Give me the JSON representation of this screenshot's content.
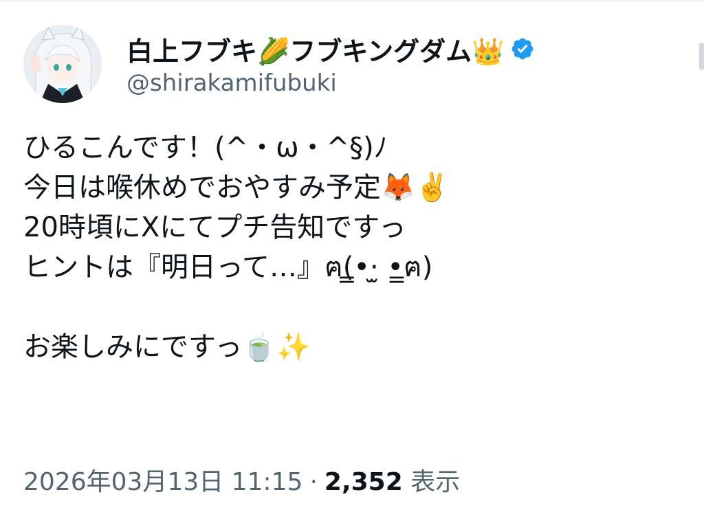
{
  "author": {
    "display_name": "白上フブキ🌽フブキングダム👑",
    "handle": "@shirakamifubuki",
    "avatar_icon": "avatar-illustration",
    "verified_icon": "verified-badge-icon"
  },
  "tweet": {
    "text": "ひるこんです！(^・ω・^§)ﾉ\n今日は喉休めでおやすみ予定🦊✌️\n20時頃にXにてプチ告知ですっ\nヒントは『明日って…』ฅ(̳•·̫ •̳ฅ)\n\nお楽しみにですっ🍵✨"
  },
  "meta": {
    "timestamp": "2026年03月13日 11:15",
    "separator": "·",
    "views_count": "2,352",
    "views_label": "表示"
  },
  "colors": {
    "text_primary": "#0f1419",
    "text_secondary": "#536471",
    "verified_blue": "#1d9bf0",
    "divider": "#eff3f4"
  }
}
